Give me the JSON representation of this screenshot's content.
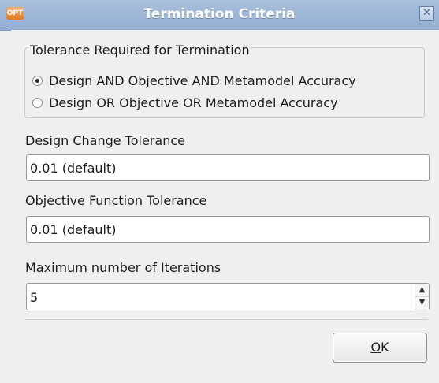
{
  "window": {
    "app_icon_text": "OPT",
    "title": "Termination Criteria",
    "close_symbol": "✕"
  },
  "tolerance_group": {
    "legend": "Tolerance Required for Termination",
    "options": [
      {
        "label": "Design AND Objective AND Metamodel Accuracy",
        "checked": true
      },
      {
        "label": "Design OR Objective OR Metamodel Accuracy",
        "checked": false
      }
    ]
  },
  "design_change": {
    "label": "Design Change Tolerance",
    "value": "0.01 (default)"
  },
  "objective_function": {
    "label": "Objective Function Tolerance",
    "value": "0.01 (default)"
  },
  "max_iterations": {
    "label": "Maximum number of Iterations",
    "value": "5",
    "up_symbol": "▲",
    "down_symbol": "▼"
  },
  "ok_button": {
    "mnemonic": "O",
    "rest": "K"
  }
}
